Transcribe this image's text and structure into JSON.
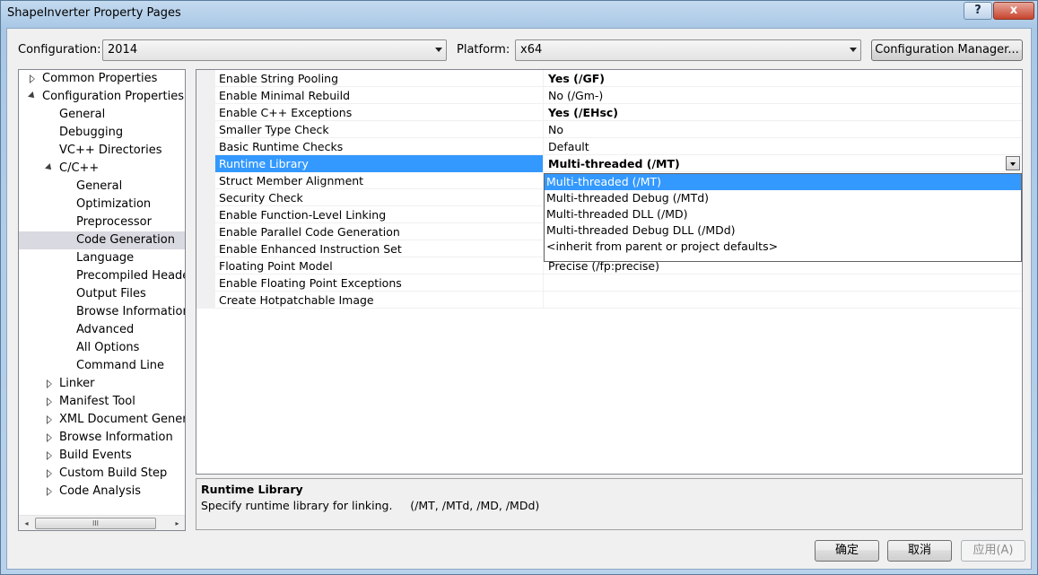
{
  "window": {
    "title": "ShapeInverter Property Pages",
    "help_glyph": "?",
    "close_glyph": "x"
  },
  "config": {
    "configuration_label": "Configuration:",
    "configuration_value": "2014",
    "platform_label": "Platform:",
    "platform_value": "x64",
    "manager_button": "Configuration Manager..."
  },
  "tree": {
    "items": [
      {
        "label": "Common Properties",
        "expander": "collapsed",
        "level": 0
      },
      {
        "label": "Configuration Properties",
        "expander": "expanded",
        "level": 0
      },
      {
        "label": "General",
        "expander": "none",
        "level": 1
      },
      {
        "label": "Debugging",
        "expander": "none",
        "level": 1
      },
      {
        "label": "VC++ Directories",
        "expander": "none",
        "level": 1
      },
      {
        "label": "C/C++",
        "expander": "expanded",
        "level": 1
      },
      {
        "label": "General",
        "expander": "none",
        "level": 2
      },
      {
        "label": "Optimization",
        "expander": "none",
        "level": 2
      },
      {
        "label": "Preprocessor",
        "expander": "none",
        "level": 2
      },
      {
        "label": "Code Generation",
        "expander": "none",
        "level": 2,
        "selected": true
      },
      {
        "label": "Language",
        "expander": "none",
        "level": 2
      },
      {
        "label": "Precompiled Headers",
        "expander": "none",
        "level": 2
      },
      {
        "label": "Output Files",
        "expander": "none",
        "level": 2
      },
      {
        "label": "Browse Information",
        "expander": "none",
        "level": 2
      },
      {
        "label": "Advanced",
        "expander": "none",
        "level": 2
      },
      {
        "label": "All Options",
        "expander": "none",
        "level": 2
      },
      {
        "label": "Command Line",
        "expander": "none",
        "level": 2
      },
      {
        "label": "Linker",
        "expander": "collapsed",
        "level": 1
      },
      {
        "label": "Manifest Tool",
        "expander": "collapsed",
        "level": 1
      },
      {
        "label": "XML Document Generator",
        "expander": "collapsed",
        "level": 1
      },
      {
        "label": "Browse Information",
        "expander": "collapsed",
        "level": 1
      },
      {
        "label": "Build Events",
        "expander": "collapsed",
        "level": 1
      },
      {
        "label": "Custom Build Step",
        "expander": "collapsed",
        "level": 1
      },
      {
        "label": "Code Analysis",
        "expander": "collapsed",
        "level": 1
      }
    ],
    "scroll_left": "◂",
    "scroll_right": "▸",
    "scroll_grip": "III"
  },
  "grid": {
    "rows": [
      {
        "name": "Enable String Pooling",
        "value": "Yes (/GF)",
        "bold": true
      },
      {
        "name": "Enable Minimal Rebuild",
        "value": "No (/Gm-)",
        "bold": false
      },
      {
        "name": "Enable C++ Exceptions",
        "value": "Yes (/EHsc)",
        "bold": true
      },
      {
        "name": "Smaller Type Check",
        "value": "No",
        "bold": false
      },
      {
        "name": "Basic Runtime Checks",
        "value": "Default",
        "bold": false
      },
      {
        "name": "Runtime Library",
        "value": "Multi-threaded (/MT)",
        "bold": true,
        "selected": true
      },
      {
        "name": "Struct Member Alignment",
        "value": "",
        "bold": false
      },
      {
        "name": "Security Check",
        "value": "",
        "bold": false
      },
      {
        "name": "Enable Function-Level Linking",
        "value": "",
        "bold": false
      },
      {
        "name": "Enable Parallel Code Generation",
        "value": "",
        "bold": false
      },
      {
        "name": "Enable Enhanced Instruction Set",
        "value": "",
        "bold": false
      },
      {
        "name": "Floating Point Model",
        "value": "Precise (/fp:precise)",
        "bold": false
      },
      {
        "name": "Enable Floating Point Exceptions",
        "value": "",
        "bold": false
      },
      {
        "name": "Create Hotpatchable Image",
        "value": "",
        "bold": false
      }
    ],
    "dropdown_options": [
      {
        "label": "Multi-threaded (/MT)",
        "highlighted": true
      },
      {
        "label": "Multi-threaded Debug (/MTd)",
        "highlighted": false
      },
      {
        "label": "Multi-threaded DLL (/MD)",
        "highlighted": false
      },
      {
        "label": "Multi-threaded Debug DLL (/MDd)",
        "highlighted": false
      },
      {
        "label": "<inherit from parent or project defaults>",
        "highlighted": false
      }
    ]
  },
  "description": {
    "title": "Runtime Library",
    "text": "Specify runtime library for linking.     (/MT, /MTd, /MD, /MDd)"
  },
  "buttons": {
    "ok": "确定",
    "cancel": "取消",
    "apply": "应用(A)"
  },
  "colors": {
    "selection": "#3399ff",
    "tree_selection": "#d9d9e1"
  }
}
